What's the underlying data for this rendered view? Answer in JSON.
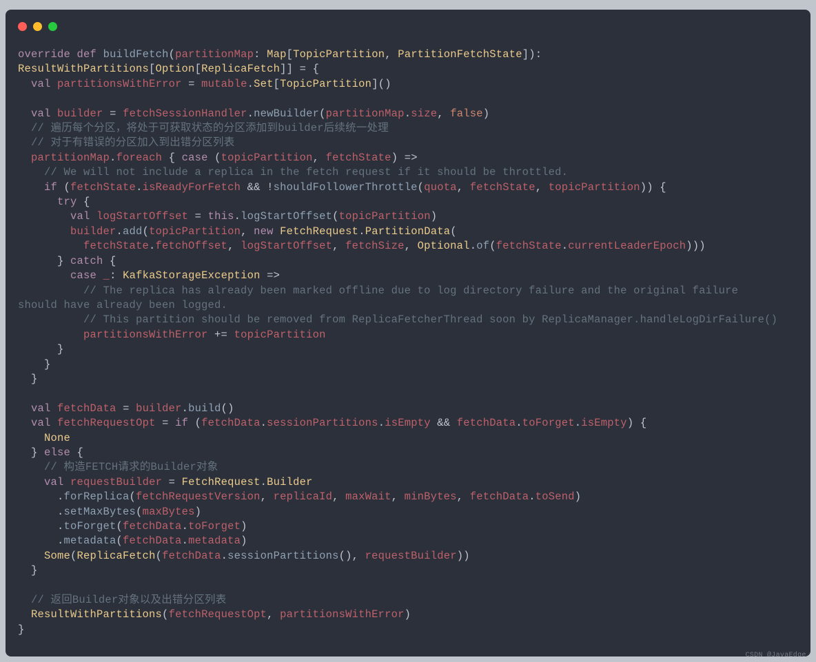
{
  "watermark": "CSDN @JavaEdge.",
  "lines": {
    "0": {
      "parts": [
        {
          "t": "override"
        },
        {
          "t": " "
        },
        {
          "t": "def"
        },
        {
          "t": " "
        },
        {
          "t": "buildFetch"
        },
        {
          "t": "("
        },
        {
          "t": "partitionMap"
        },
        {
          "t": ": "
        },
        {
          "t": "Map"
        },
        {
          "t": "["
        },
        {
          "t": "TopicPartition"
        },
        {
          "t": ", "
        },
        {
          "t": "PartitionFetchState"
        },
        {
          "t": "]):"
        }
      ]
    },
    "1": {
      "parts": [
        {
          "t": "ResultWithPartitions"
        },
        {
          "t": "["
        },
        {
          "t": "Option"
        },
        {
          "t": "["
        },
        {
          "t": "ReplicaFetch"
        },
        {
          "t": "]] = {"
        }
      ]
    },
    "2": {
      "parts": [
        {
          "t": "  "
        },
        {
          "t": "val"
        },
        {
          "t": " "
        },
        {
          "t": "partitionsWithError"
        },
        {
          "t": " = "
        },
        {
          "t": "mutable"
        },
        {
          "t": "."
        },
        {
          "t": "Set"
        },
        {
          "t": "["
        },
        {
          "t": "TopicPartition"
        },
        {
          "t": "]()"
        }
      ]
    },
    "3": {
      "t": " "
    },
    "4": {
      "parts": [
        {
          "t": "  "
        },
        {
          "t": "val"
        },
        {
          "t": " "
        },
        {
          "t": "builder"
        },
        {
          "t": " = "
        },
        {
          "t": "fetchSessionHandler"
        },
        {
          "t": "."
        },
        {
          "t": "newBuilder"
        },
        {
          "t": "("
        },
        {
          "t": "partitionMap"
        },
        {
          "t": "."
        },
        {
          "t": "size"
        },
        {
          "t": ", "
        },
        {
          "t": "false"
        },
        {
          "t": ")"
        }
      ]
    },
    "5": {
      "t": "  // 遍历每个分区，将处于可获取状态的分区添加到builder后续统一处理"
    },
    "6": {
      "t": "  // 对于有错误的分区加入到出错分区列表"
    },
    "7": {
      "parts": [
        {
          "t": "  "
        },
        {
          "t": "partitionMap"
        },
        {
          "t": "."
        },
        {
          "t": "foreach"
        },
        {
          "t": " { "
        },
        {
          "t": "case"
        },
        {
          "t": " ("
        },
        {
          "t": "topicPartition"
        },
        {
          "t": ", "
        },
        {
          "t": "fetchState"
        },
        {
          "t": ") =>"
        }
      ]
    },
    "8": {
      "t": "    // We will not include a replica in the fetch request if it should be throttled."
    },
    "9": {
      "parts": [
        {
          "t": "    "
        },
        {
          "t": "if"
        },
        {
          "t": " ("
        },
        {
          "t": "fetchState"
        },
        {
          "t": "."
        },
        {
          "t": "isReadyForFetch"
        },
        {
          "t": " && !"
        },
        {
          "t": "shouldFollowerThrottle"
        },
        {
          "t": "("
        },
        {
          "t": "quota"
        },
        {
          "t": ", "
        },
        {
          "t": "fetchState"
        },
        {
          "t": ", "
        },
        {
          "t": "topicPartition"
        },
        {
          "t": ")) {"
        }
      ]
    },
    "10": {
      "parts": [
        {
          "t": "      "
        },
        {
          "t": "try"
        },
        {
          "t": " {"
        }
      ]
    },
    "11": {
      "parts": [
        {
          "t": "        "
        },
        {
          "t": "val"
        },
        {
          "t": " "
        },
        {
          "t": "logStartOffset"
        },
        {
          "t": " = "
        },
        {
          "t": "this"
        },
        {
          "t": "."
        },
        {
          "t": "logStartOffset"
        },
        {
          "t": "("
        },
        {
          "t": "topicPartition"
        },
        {
          "t": ")"
        }
      ]
    },
    "12": {
      "parts": [
        {
          "t": "        "
        },
        {
          "t": "builder"
        },
        {
          "t": "."
        },
        {
          "t": "add"
        },
        {
          "t": "("
        },
        {
          "t": "topicPartition"
        },
        {
          "t": ", "
        },
        {
          "t": "new"
        },
        {
          "t": " "
        },
        {
          "t": "FetchRequest"
        },
        {
          "t": "."
        },
        {
          "t": "PartitionData"
        },
        {
          "t": "("
        }
      ]
    },
    "13": {
      "parts": [
        {
          "t": "          "
        },
        {
          "t": "fetchState"
        },
        {
          "t": "."
        },
        {
          "t": "fetchOffset"
        },
        {
          "t": ", "
        },
        {
          "t": "logStartOffset"
        },
        {
          "t": ", "
        },
        {
          "t": "fetchSize"
        },
        {
          "t": ", "
        },
        {
          "t": "Optional"
        },
        {
          "t": "."
        },
        {
          "t": "of"
        },
        {
          "t": "("
        },
        {
          "t": "fetchState"
        },
        {
          "t": "."
        },
        {
          "t": "currentLeaderEpoch"
        },
        {
          "t": ")))"
        }
      ]
    },
    "14": {
      "parts": [
        {
          "t": "      } "
        },
        {
          "t": "catch"
        },
        {
          "t": " {"
        }
      ]
    },
    "15": {
      "parts": [
        {
          "t": "        "
        },
        {
          "t": "case"
        },
        {
          "t": " "
        },
        {
          "t": "_"
        },
        {
          "t": ": "
        },
        {
          "t": "KafkaStorageException"
        },
        {
          "t": " =>"
        }
      ]
    },
    "16": {
      "t": "          // The replica has already been marked offline due to log directory failure and the original failure\nshould have already been logged."
    },
    "17": {
      "t": "          // This partition should be removed from ReplicaFetcherThread soon by ReplicaManager.handleLogDirFailure()"
    },
    "18": {
      "parts": [
        {
          "t": "          "
        },
        {
          "t": "partitionsWithError"
        },
        {
          "t": " += "
        },
        {
          "t": "topicPartition"
        }
      ]
    },
    "19": {
      "t": "      }"
    },
    "20": {
      "t": "    }"
    },
    "21": {
      "t": "  }"
    },
    "22": {
      "t": " "
    },
    "23": {
      "parts": [
        {
          "t": "  "
        },
        {
          "t": "val"
        },
        {
          "t": " "
        },
        {
          "t": "fetchData"
        },
        {
          "t": " = "
        },
        {
          "t": "builder"
        },
        {
          "t": "."
        },
        {
          "t": "build"
        },
        {
          "t": "()"
        }
      ]
    },
    "24": {
      "parts": [
        {
          "t": "  "
        },
        {
          "t": "val"
        },
        {
          "t": " "
        },
        {
          "t": "fetchRequestOpt"
        },
        {
          "t": " = "
        },
        {
          "t": "if"
        },
        {
          "t": " ("
        },
        {
          "t": "fetchData"
        },
        {
          "t": "."
        },
        {
          "t": "sessionPartitions"
        },
        {
          "t": "."
        },
        {
          "t": "isEmpty"
        },
        {
          "t": " && "
        },
        {
          "t": "fetchData"
        },
        {
          "t": "."
        },
        {
          "t": "toForget"
        },
        {
          "t": "."
        },
        {
          "t": "isEmpty"
        },
        {
          "t": ") {"
        }
      ]
    },
    "25": {
      "parts": [
        {
          "t": "    "
        },
        {
          "t": "None"
        }
      ]
    },
    "26": {
      "parts": [
        {
          "t": "  } "
        },
        {
          "t": "else"
        },
        {
          "t": " {"
        }
      ]
    },
    "27": {
      "t": "    // 构造FETCH请求的Builder对象"
    },
    "28": {
      "parts": [
        {
          "t": "    "
        },
        {
          "t": "val"
        },
        {
          "t": " "
        },
        {
          "t": "requestBuilder"
        },
        {
          "t": " = "
        },
        {
          "t": "FetchRequest"
        },
        {
          "t": "."
        },
        {
          "t": "Builder"
        }
      ]
    },
    "29": {
      "parts": [
        {
          "t": "      ."
        },
        {
          "t": "forReplica"
        },
        {
          "t": "("
        },
        {
          "t": "fetchRequestVersion"
        },
        {
          "t": ", "
        },
        {
          "t": "replicaId"
        },
        {
          "t": ", "
        },
        {
          "t": "maxWait"
        },
        {
          "t": ", "
        },
        {
          "t": "minBytes"
        },
        {
          "t": ", "
        },
        {
          "t": "fetchData"
        },
        {
          "t": "."
        },
        {
          "t": "toSend"
        },
        {
          "t": ")"
        }
      ]
    },
    "30": {
      "parts": [
        {
          "t": "      ."
        },
        {
          "t": "setMaxBytes"
        },
        {
          "t": "("
        },
        {
          "t": "maxBytes"
        },
        {
          "t": ")"
        }
      ]
    },
    "31": {
      "parts": [
        {
          "t": "      ."
        },
        {
          "t": "toForget"
        },
        {
          "t": "("
        },
        {
          "t": "fetchData"
        },
        {
          "t": "."
        },
        {
          "t": "toForget"
        },
        {
          "t": ")"
        }
      ]
    },
    "32": {
      "parts": [
        {
          "t": "      ."
        },
        {
          "t": "metadata"
        },
        {
          "t": "("
        },
        {
          "t": "fetchData"
        },
        {
          "t": "."
        },
        {
          "t": "metadata"
        },
        {
          "t": ")"
        }
      ]
    },
    "33": {
      "parts": [
        {
          "t": "    "
        },
        {
          "t": "Some"
        },
        {
          "t": "("
        },
        {
          "t": "ReplicaFetch"
        },
        {
          "t": "("
        },
        {
          "t": "fetchData"
        },
        {
          "t": "."
        },
        {
          "t": "sessionPartitions"
        },
        {
          "t": "(), "
        },
        {
          "t": "requestBuilder"
        },
        {
          "t": "))"
        }
      ]
    },
    "34": {
      "t": "  }"
    },
    "35": {
      "t": " "
    },
    "36": {
      "t": "  // 返回Builder对象以及出错分区列表"
    },
    "37": {
      "parts": [
        {
          "t": "  "
        },
        {
          "t": "ResultWithPartitions"
        },
        {
          "t": "("
        },
        {
          "t": "fetchRequestOpt"
        },
        {
          "t": ", "
        },
        {
          "t": "partitionsWithError"
        },
        {
          "t": ")"
        }
      ]
    },
    "38": {
      "t": "}"
    }
  }
}
